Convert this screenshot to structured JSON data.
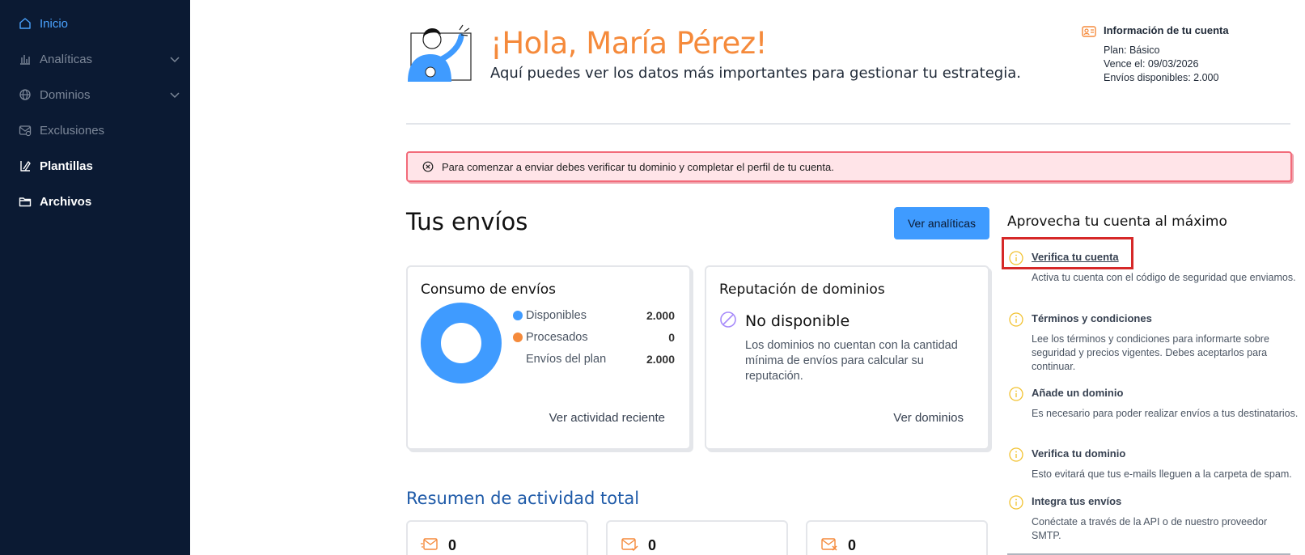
{
  "sidebar": {
    "items": [
      {
        "label": "Inicio",
        "icon": "home-icon"
      },
      {
        "label": "Analíticas",
        "icon": "bar-chart-icon"
      },
      {
        "label": "Dominios",
        "icon": "globe-icon"
      },
      {
        "label": "Exclusiones",
        "icon": "mail-block-icon"
      },
      {
        "label": "Plantillas",
        "icon": "template-icon"
      },
      {
        "label": "Archivos",
        "icon": "folder-icon"
      }
    ]
  },
  "header": {
    "greeting": "¡Hola, María Pérez!",
    "subtitle": "Aquí puedes ver los datos más importantes para gestionar tu estrategia."
  },
  "account": {
    "title": "Información de tu cuenta",
    "plan": "Plan: Básico",
    "expires": "Vence el: 09/03/2026",
    "available": "Envíos disponibles: 2.000"
  },
  "alert": {
    "text": "Para comenzar a enviar debes verificar tu dominio y completar el perfil de tu cuenta."
  },
  "sends": {
    "title": "Tus envíos",
    "button": "Ver analíticas",
    "consumption": {
      "title": "Consumo de envíos",
      "rows": [
        {
          "label": "Disponibles",
          "value": "2.000",
          "color": "#3f9bff"
        },
        {
          "label": "Procesados",
          "value": "0",
          "color": "#f58a3b"
        },
        {
          "label": "Envíos del plan",
          "value": "2.000"
        }
      ],
      "link": "Ver actividad reciente"
    },
    "reputation": {
      "title": "Reputación de dominios",
      "status": "No disponible",
      "description": "Los dominios no cuentan con la cantidad mínima de envíos para calcular su reputación.",
      "link": "Ver dominios"
    }
  },
  "summary": {
    "title": "Resumen de actividad total",
    "cards": [
      {
        "value": "0",
        "icon": "mail-sent-icon"
      },
      {
        "value": "0",
        "icon": "mail-check-icon"
      },
      {
        "value": "0",
        "icon": "mail-x-icon"
      }
    ]
  },
  "tips": {
    "title": "Aprovecha tu cuenta al máximo",
    "items": [
      {
        "title": "Verifica tu cuenta",
        "description": "Activa tu cuenta con el código de seguridad que enviamos."
      },
      {
        "title": "Términos y condiciones",
        "description": "Lee los términos y condiciones para informarte sobre seguridad y precios vigentes. Debes aceptarlos para continuar."
      },
      {
        "title": "Añade un dominio",
        "description": "Es necesario para poder realizar envíos a tus destinatarios."
      },
      {
        "title": "Verifica tu dominio",
        "description": "Esto evitará que tus e-mails lleguen a la carpeta de spam."
      },
      {
        "title": "Integra tus envíos",
        "description": "Conéctate a través de la API o de nuestro proveedor SMTP."
      }
    ]
  },
  "colors": {
    "sidebar": "#0b1a33",
    "accent": "#3f9bff",
    "greeting": "#f58a3b",
    "alert_bg": "#ffe4e8",
    "alert_border": "#f26b7a"
  }
}
